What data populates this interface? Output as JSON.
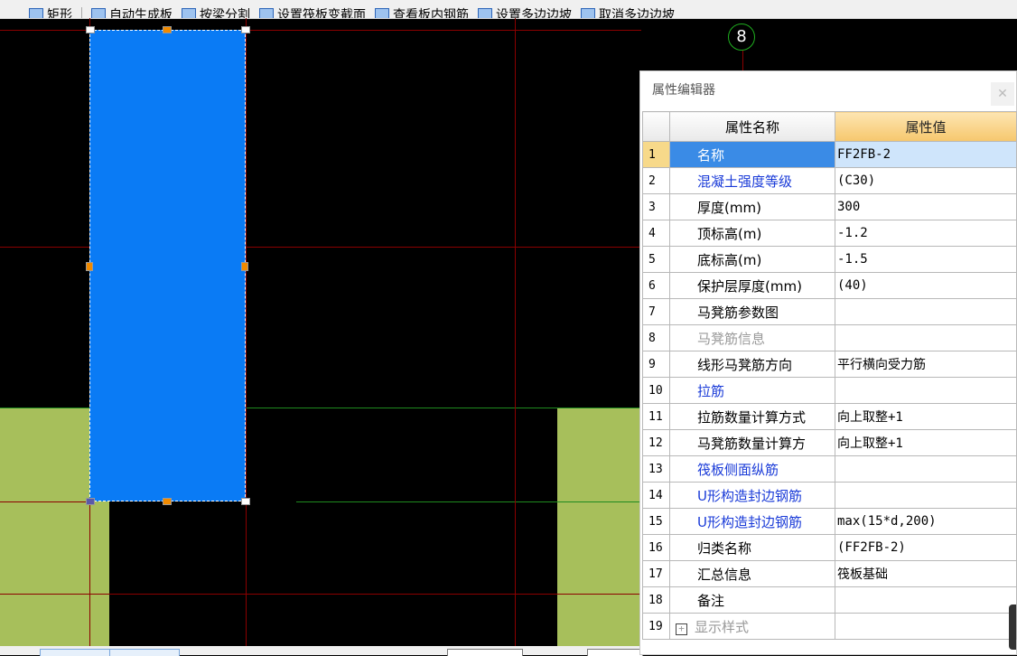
{
  "toolbar": {
    "items": [
      {
        "label": "矩形",
        "icon": "rectangle-icon"
      },
      {
        "label": "自动生成板",
        "icon": "auto-generate-icon"
      },
      {
        "label": "按梁分割",
        "icon": "split-by-beam-icon"
      },
      {
        "label": "设置筏板变截面",
        "icon": "variable-section-icon"
      },
      {
        "label": "查看板内钢筋",
        "icon": "view-rebar-icon"
      },
      {
        "label": "设置多边边坡",
        "icon": "set-slope-icon"
      },
      {
        "label": "取消多边边坡",
        "icon": "cancel-slope-icon"
      }
    ]
  },
  "canvas": {
    "axis_label": "8",
    "colors": {
      "background": "#000000",
      "slab": "#0a7bf5",
      "foundation": "#a7bf5b",
      "grid_line": "#8b0000",
      "axis_line": "#1f8a1f"
    }
  },
  "property_editor": {
    "title": "属性编辑器",
    "close_icon": "close-icon",
    "header_name": "属性名称",
    "header_value": "属性值",
    "rows": [
      {
        "index": "1",
        "name": "名称",
        "value": "FF2FB-2",
        "style": "normal"
      },
      {
        "index": "2",
        "name": "混凝土强度等级",
        "value": "(C30)",
        "style": "blue"
      },
      {
        "index": "3",
        "name": "厚度(mm)",
        "value": "300",
        "style": "normal"
      },
      {
        "index": "4",
        "name": "顶标高(m)",
        "value": "-1.2",
        "style": "normal"
      },
      {
        "index": "5",
        "name": "底标高(m)",
        "value": "-1.5",
        "style": "normal"
      },
      {
        "index": "6",
        "name": "保护层厚度(mm)",
        "value": "(40)",
        "style": "normal"
      },
      {
        "index": "7",
        "name": "马凳筋参数图",
        "value": "",
        "style": "normal"
      },
      {
        "index": "8",
        "name": "马凳筋信息",
        "value": "",
        "style": "gray"
      },
      {
        "index": "9",
        "name": "线形马凳筋方向",
        "value": "平行横向受力筋",
        "style": "normal"
      },
      {
        "index": "10",
        "name": "拉筋",
        "value": "",
        "style": "blue"
      },
      {
        "index": "11",
        "name": "拉筋数量计算方式",
        "value": "向上取整+1",
        "style": "normal"
      },
      {
        "index": "12",
        "name": "马凳筋数量计算方",
        "value": "向上取整+1",
        "style": "normal"
      },
      {
        "index": "13",
        "name": "筏板侧面纵筋",
        "value": "",
        "style": "blue"
      },
      {
        "index": "14",
        "name": "U形构造封边钢筋",
        "value": "",
        "style": "blue"
      },
      {
        "index": "15",
        "name": "U形构造封边钢筋",
        "value": "max(15*d,200)",
        "style": "blue"
      },
      {
        "index": "16",
        "name": "归类名称",
        "value": "(FF2FB-2)",
        "style": "normal"
      },
      {
        "index": "17",
        "name": "汇总信息",
        "value": "筏板基础",
        "style": "normal"
      },
      {
        "index": "18",
        "name": "备注",
        "value": "",
        "style": "normal"
      },
      {
        "index": "19",
        "name": "显示样式",
        "value": "",
        "style": "gray",
        "expander": "+"
      }
    ]
  }
}
